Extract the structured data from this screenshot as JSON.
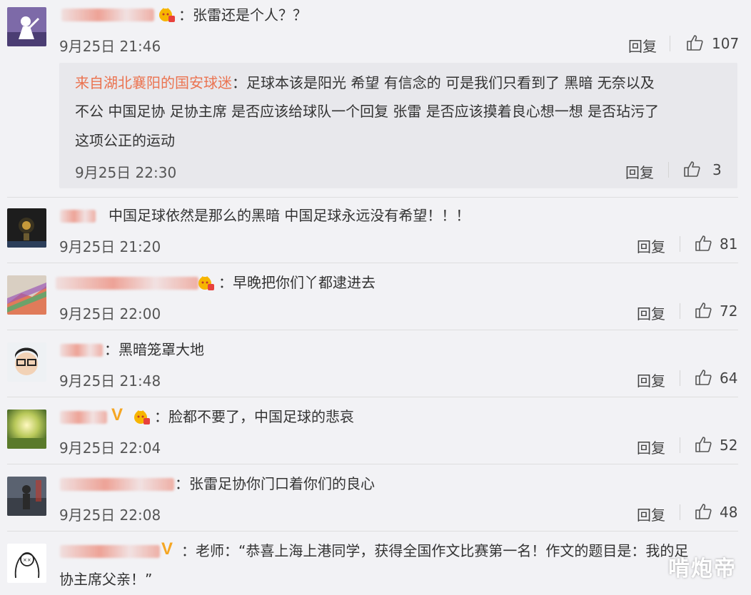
{
  "comments": [
    {
      "text": "：张雷还是个人？？",
      "time": "9月25日 21:46",
      "reply": "回复",
      "likes": "107",
      "subreply": {
        "user": "来自湖北襄阳的国安球迷",
        "lines": [
          "：足球本该是阳光 希望 有信念的 可是我们只看到了 黑暗 无奈以及",
          "不公 中国足协 足协主席 是否应该给球队一个回复 张雷 是否应该摸着良心想一想 是否玷污了",
          "这项公正的运动"
        ],
        "time": "9月25日 22:30",
        "reply": "回复",
        "likes": "3"
      }
    },
    {
      "text": "中国足球依然是那么的黑暗 中国足球永远没有希望！！！",
      "time": "9月25日 21:20",
      "reply": "回复",
      "likes": "81"
    },
    {
      "text": "：早晚把你们丫都逮进去",
      "time": "9月25日 22:00",
      "reply": "回复",
      "likes": "72"
    },
    {
      "text": "：黑暗笼罩大地",
      "time": "9月25日 21:48",
      "reply": "回复",
      "likes": "64"
    },
    {
      "text": "：脸都不要了，中国足球的悲哀",
      "time": "9月25日 22:04",
      "reply": "回复",
      "likes": "52"
    },
    {
      "text": "：张雷足协你门口着你们的良心",
      "time": "9月25日 22:08",
      "reply": "回复",
      "likes": "48"
    },
    {
      "text": "：老师：“恭喜上海上港同学，获得全国作文比赛第一名！作文的题目是：我的足",
      "text2": "协主席父亲！”"
    }
  ],
  "watermark": "啃炮帝",
  "colors": {
    "background": "#f2f2f5",
    "subreply_bg": "#e8e8ec",
    "subreply_user": "#eb7350",
    "vip": "#f5a623",
    "badge_red": "#e8413c"
  },
  "icons": {
    "like": "thumbs-up-icon",
    "badge": "crown-level-badge-icon",
    "vip": "vip-v-icon"
  }
}
